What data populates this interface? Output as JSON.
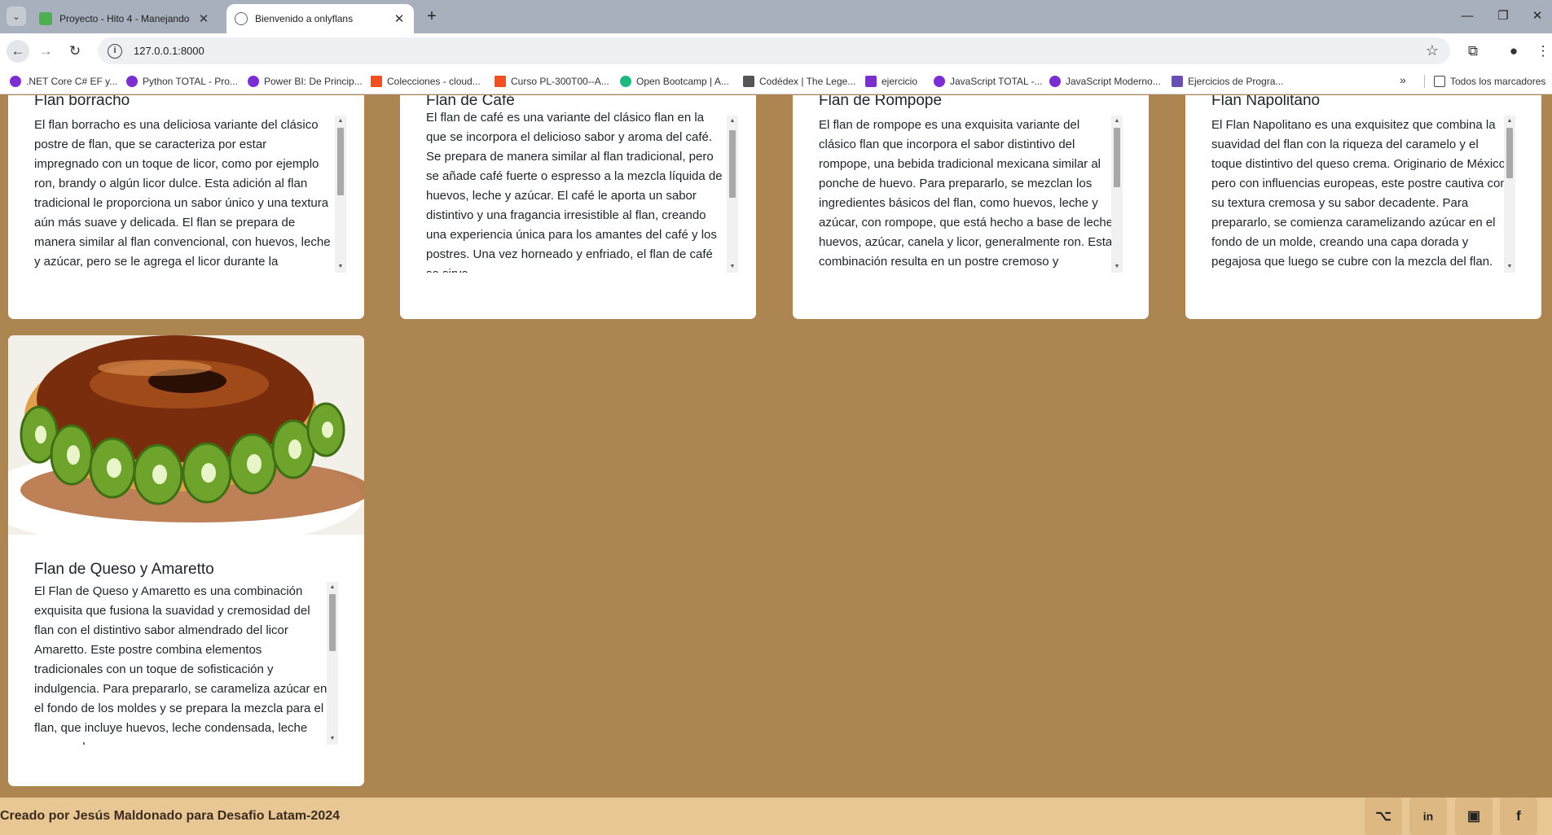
{
  "browser": {
    "tabs": [
      {
        "title": "Proyecto - Hito 4 - Manejando",
        "favicon_color": "#4caf50"
      },
      {
        "title": "Bienvenido a onlyflans",
        "favicon_color": "#5f6368"
      }
    ],
    "url": "127.0.0.1:8000",
    "bookmarks": [
      {
        "label": ".NET Core C# EF y...",
        "icon_color": "#7b2fd0"
      },
      {
        "label": "Python TOTAL - Pro...",
        "icon_color": "#7b2fd0"
      },
      {
        "label": "Power BI: De Princip...",
        "icon_color": "#7b2fd0"
      },
      {
        "label": "Colecciones - cloud...",
        "icon_color": "#f25022"
      },
      {
        "label": "Curso PL-300T00--A...",
        "icon_color": "#f25022"
      },
      {
        "label": "Open Bootcamp | A...",
        "icon_color": "#1eb980"
      },
      {
        "label": "Codédex | The Lege...",
        "icon_color": "#555555"
      },
      {
        "label": "ejercicio",
        "icon_color": "#7b2fd0"
      },
      {
        "label": "JavaScript TOTAL -...",
        "icon_color": "#7b2fd0"
      },
      {
        "label": "JavaScript Moderno...",
        "icon_color": "#7b2fd0"
      },
      {
        "label": "Ejercicios de Progra...",
        "icon_color": "#6a4fb3"
      }
    ],
    "all_bookmarks_label": "Todos los marcadores"
  },
  "cards": [
    {
      "title": "Flan borracho",
      "description": "El flan borracho es una deliciosa variante del clásico postre de flan, que se caracteriza por estar impregnado con un toque de licor, como por ejemplo ron, brandy o algún licor dulce. Esta adición al flan tradicional le proporciona un sabor único y una textura aún más suave y delicada. El flan se prepara de manera similar al flan convencional, con huevos, leche y azúcar, pero se le agrega el licor durante la preparación de la mezcla."
    },
    {
      "title": "Flan de Café",
      "description": "El flan de café es una variante del clásico flan en la que se incorpora el delicioso sabor y aroma del café. Se prepara de manera similar al flan tradicional, pero se añade café fuerte o espresso a la mezcla líquida de huevos, leche y azúcar. El café le aporta un sabor distintivo y una fragancia irresistible al flan, creando una experiencia única para los amantes del café y los postres. Una vez horneado y enfriado, el flan de café se sirve."
    },
    {
      "title": "Flan de Rompope",
      "description": "El flan de rompope es una exquisita variante del clásico flan que incorpora el sabor distintivo del rompope, una bebida tradicional mexicana similar al ponche de huevo. Para prepararlo, se mezclan los ingredientes básicos del flan, como huevos, leche y azúcar, con rompope, que está hecho a base de leche, huevos, azúcar, canela y licor, generalmente ron. Esta combinación resulta en un postre cremoso y aromático."
    },
    {
      "title": "Flan Napolitano",
      "description": "El Flan Napolitano es una exquisitez que combina la suavidad del flan con la riqueza del caramelo y el toque distintivo del queso crema. Originario de México pero con influencias europeas, este postre cautiva con su textura cremosa y su sabor decadente. Para prepararlo, se comienza caramelizando azúcar en el fondo de un molde, creando una capa dorada y pegajosa que luego se cubre con la mezcla del flan."
    },
    {
      "title": "Flan de Queso y Amaretto",
      "description": "El Flan de Queso y Amaretto es una combinación exquisita que fusiona la suavidad y cremosidad del flan con el distintivo sabor almendrado del licor Amaretto. Este postre combina elementos tradicionales con un toque de sofisticación y indulgencia. Para prepararlo, se carameliza azúcar en el fondo de los moldes y se prepara la mezcla para el flan, que incluye huevos, leche condensada, leche evaporada y queso crema."
    }
  ],
  "footer": {
    "credit": "Creado por Jesús Maldonado para Desafio Latam-2024",
    "social": [
      "github-icon",
      "linkedin-icon",
      "twitter-icon",
      "facebook-icon"
    ]
  }
}
